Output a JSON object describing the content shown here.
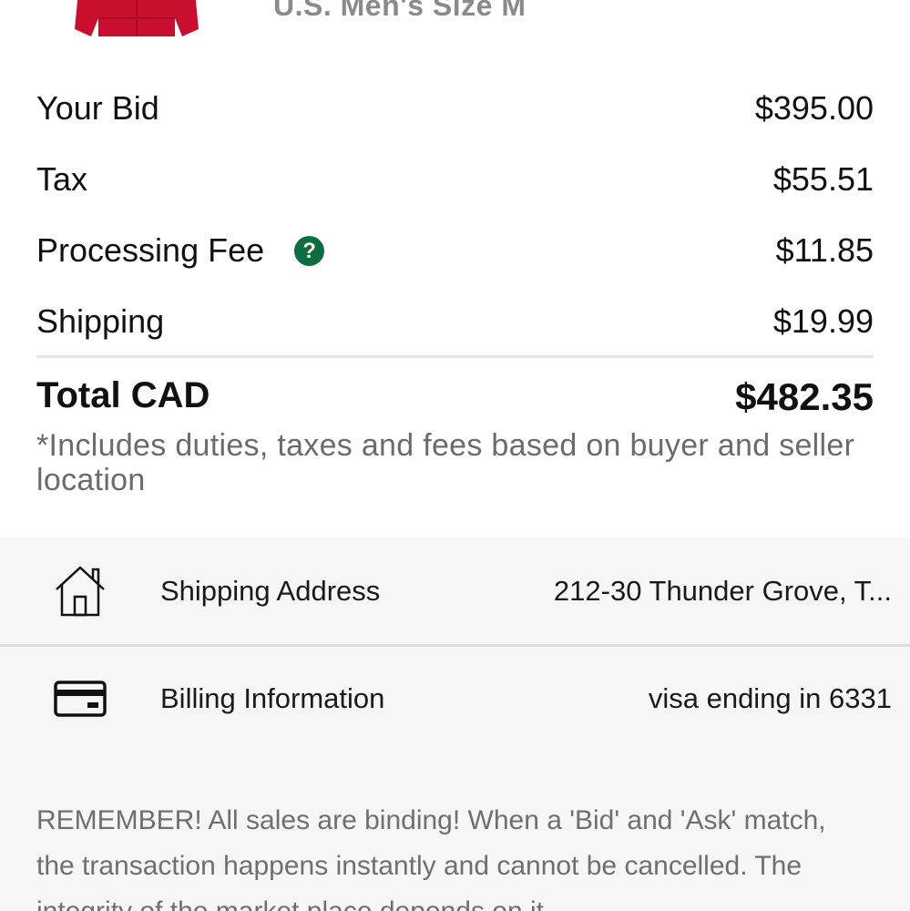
{
  "product": {
    "size": "U.S. Men's Size M",
    "image_icon": "red-hoodie-thumbnail"
  },
  "summary": {
    "bid_label": "Your Bid",
    "bid_value": "$395.00",
    "tax_label": "Tax",
    "tax_value": "$55.51",
    "fee_label": "Processing Fee",
    "fee_help_icon": "question-icon",
    "fee_help_glyph": "?",
    "fee_value": "$11.85",
    "shipping_label": "Shipping",
    "shipping_value": "$19.99",
    "total_label": "Total CAD",
    "total_value": "$482.35",
    "footnote": "*Includes duties, taxes and fees based on buyer and seller location"
  },
  "shipping_address": {
    "icon": "home-icon",
    "label": "Shipping Address",
    "value": "212-30 Thunder Grove,  T..."
  },
  "billing": {
    "icon": "credit-card-icon",
    "label": "Billing Information",
    "value": "visa ending in 6331"
  },
  "reminder": "REMEMBER! All sales are binding! When a 'Bid' and 'Ask' match, the transaction happens instantly and cannot be cancelled. The integrity of the market place depends on it.",
  "colors": {
    "help_icon": "#0d6e3f",
    "product_red": "#c8102e",
    "muted_text": "#6b6b6b",
    "section_bg": "#f6f6f6"
  }
}
